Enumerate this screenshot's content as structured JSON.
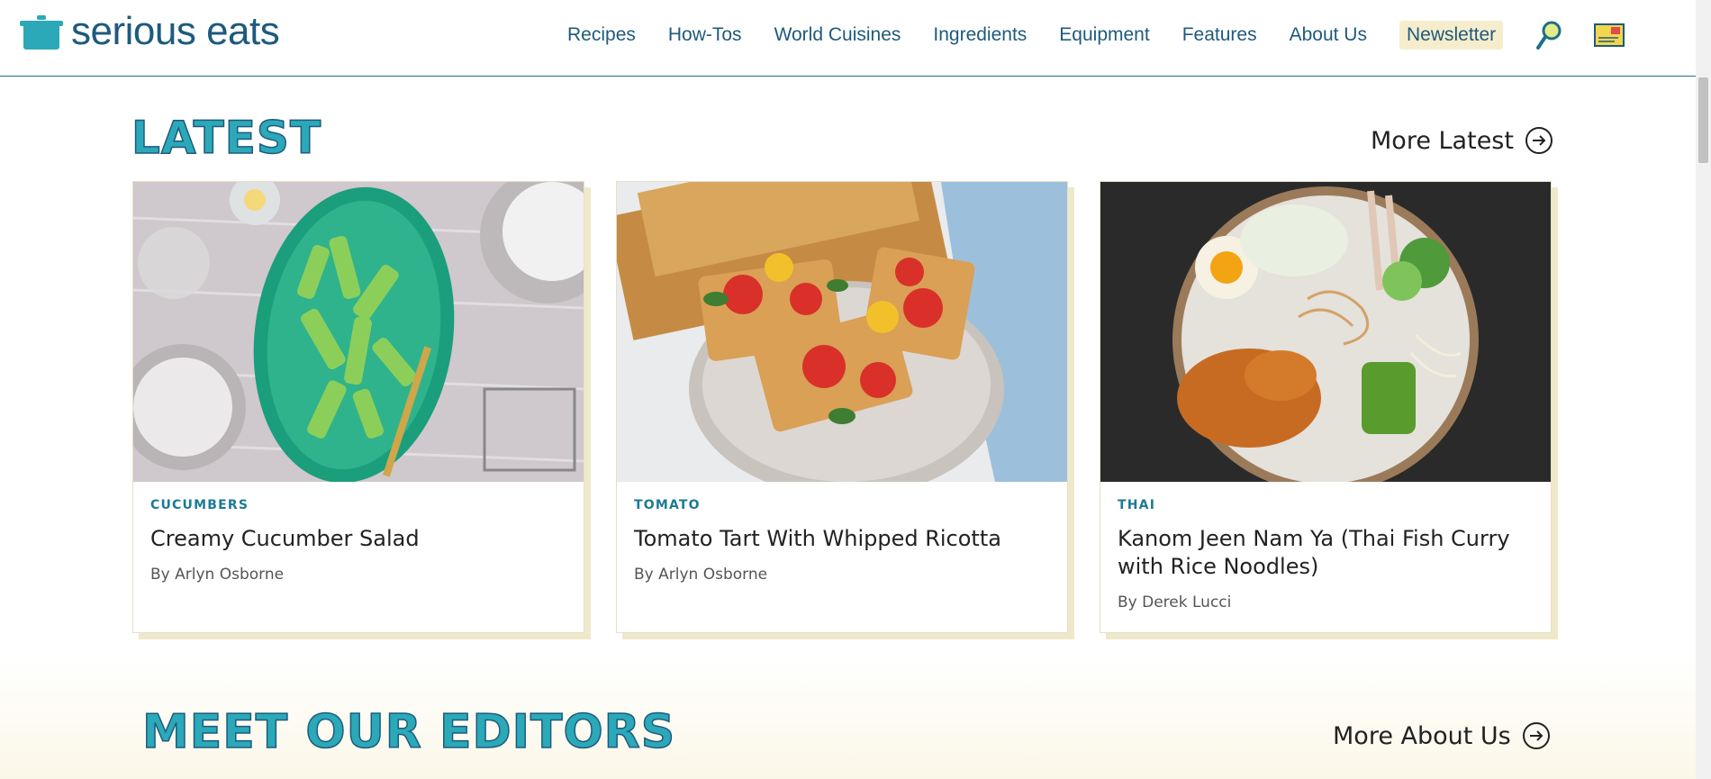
{
  "header": {
    "logo_text": "serious eats",
    "nav": [
      {
        "label": "Recipes"
      },
      {
        "label": "How-Tos"
      },
      {
        "label": "World Cuisines"
      },
      {
        "label": "Ingredients"
      },
      {
        "label": "Equipment"
      },
      {
        "label": "Features"
      },
      {
        "label": "About Us"
      }
    ],
    "newsletter_label": "Newsletter"
  },
  "latest": {
    "title": "LATEST",
    "more_label": "More Latest",
    "cards": [
      {
        "category": "CUCUMBERS",
        "title": "Creamy Cucumber Salad",
        "author": "By Arlyn Osborne"
      },
      {
        "category": "TOMATO",
        "title": "Tomato Tart With Whipped Ricotta",
        "author": "By Arlyn Osborne"
      },
      {
        "category": "THAI",
        "title": "Kanom Jeen Nam Ya (Thai Fish Curry with Rice Noodles)",
        "author": "By Derek Lucci"
      }
    ]
  },
  "editors": {
    "title": "MEET OUR EDITORS",
    "more_label": "More About Us"
  },
  "colors": {
    "brand_blue": "#1e5a7d",
    "accent_teal": "#2ba9b8",
    "newsletter_bg": "#f6edcc",
    "card_shadow": "#efe9cb"
  },
  "icons": [
    "pot-logo-icon",
    "search-icon",
    "magazine-icon",
    "arrow-right-circle-icon"
  ]
}
